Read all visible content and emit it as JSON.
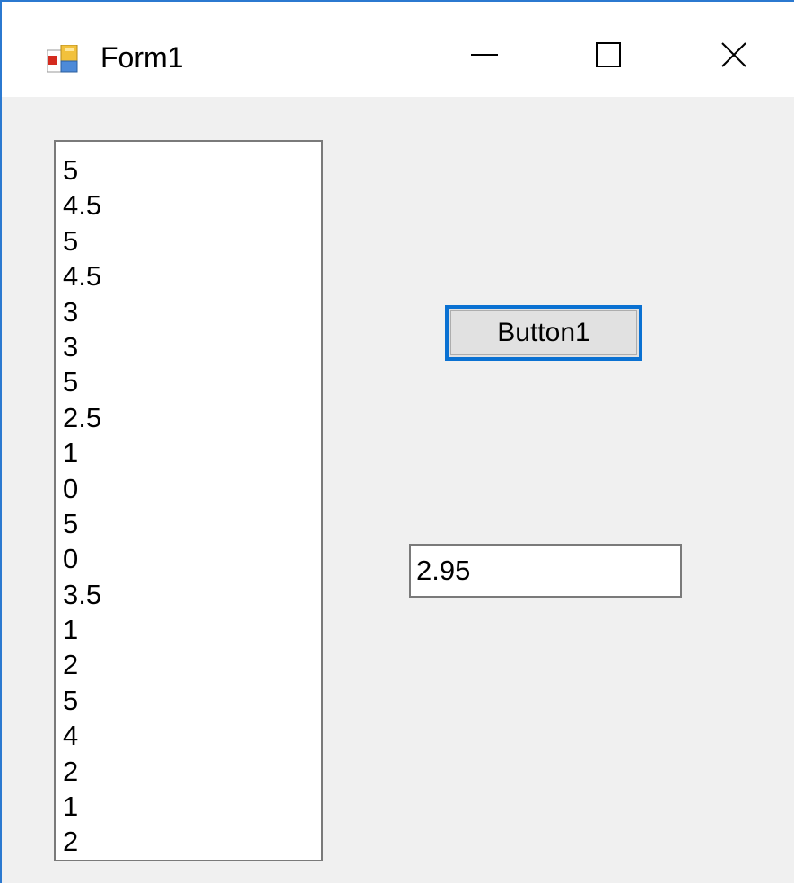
{
  "window": {
    "title": "Form1",
    "accent_color": "#2b79d0",
    "icons": {
      "app": "app-form-icon",
      "minimize": "minimize-icon",
      "maximize": "maximize-icon",
      "close": "close-icon"
    }
  },
  "listbox": {
    "items": [
      "5",
      "4.5",
      "5",
      "4.5",
      "3",
      "3",
      "5",
      "2.5",
      "1",
      "0",
      "5",
      "0",
      "3.5",
      "1",
      "2",
      "5",
      "4",
      "2",
      "1",
      "2"
    ]
  },
  "button1": {
    "label": "Button1",
    "focus_color": "#0a71d2"
  },
  "textbox": {
    "value": "2.95"
  }
}
